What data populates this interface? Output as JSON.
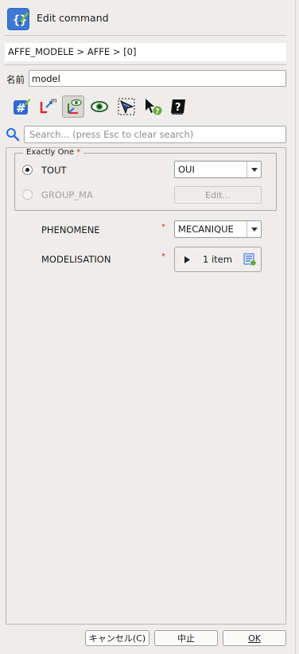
{
  "window": {
    "title": "Edit command"
  },
  "breadcrumb": "AFFE_MODELE > AFFE > [0]",
  "name_field": {
    "label": "名前",
    "value": "model"
  },
  "toolbar": [
    {
      "icon": "hash-edit-icon"
    },
    {
      "icon": "lm-icon"
    },
    {
      "icon": "axis-eye-icon",
      "active": true
    },
    {
      "icon": "eye-icon"
    },
    {
      "icon": "selection-tool-icon"
    },
    {
      "icon": "whats-this-icon"
    },
    {
      "icon": "help-book-icon"
    }
  ],
  "search": {
    "placeholder": "Search... (press Esc to clear search)",
    "value": ""
  },
  "exactly_one": {
    "title": "Exactly One",
    "required_mark": "*",
    "options": [
      {
        "label": "TOUT",
        "selected": true,
        "value": "OUI"
      },
      {
        "label": "GROUP_MA",
        "selected": false,
        "edit_label": "Edit..."
      }
    ]
  },
  "fields": [
    {
      "label": "PHENOMENE",
      "required_mark": "*",
      "value": "MECANIQUE"
    },
    {
      "label": "MODELISATION",
      "required_mark": "*",
      "items_text": "1 item"
    }
  ],
  "footer": {
    "cancel": "キャンセル(C)",
    "abort": "中止",
    "ok": "OK"
  },
  "colors": {
    "required": "#d42b2b",
    "panel_bg": "#efedeb"
  }
}
